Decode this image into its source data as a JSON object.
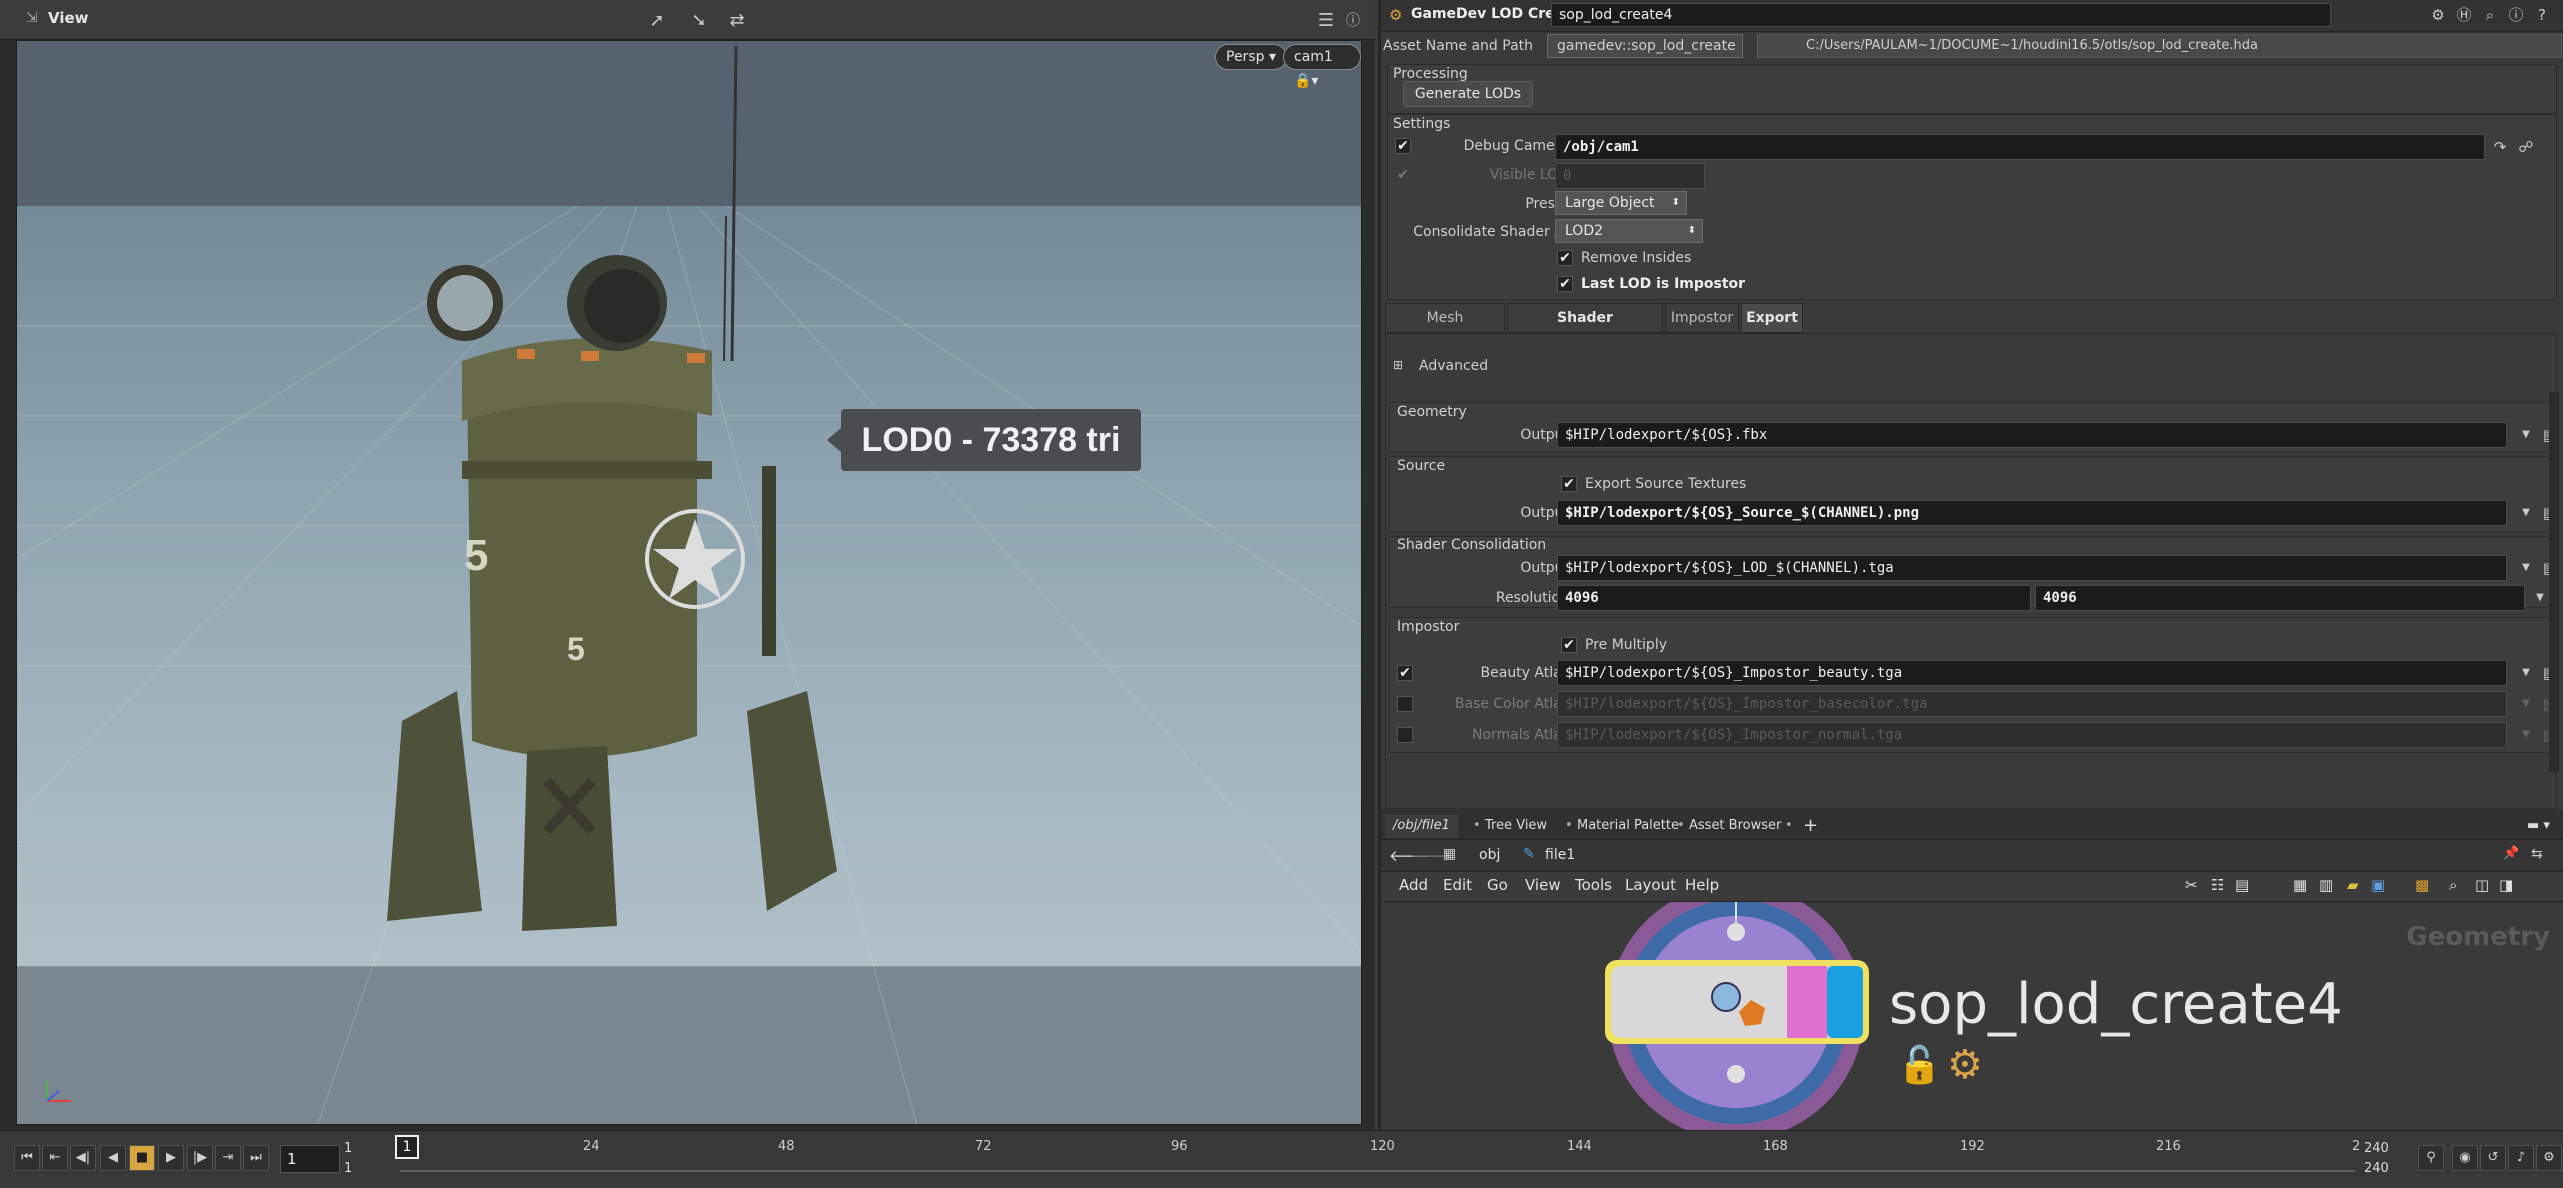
{
  "viewport": {
    "title": "View",
    "camera_mode": "Persp",
    "camera_name": "cam1",
    "lod_overlay": "LOD0 - 73378 tri",
    "tool_icons": [
      "select-arrow-icon",
      "transform-arrow-icon",
      "snap-icon"
    ],
    "robot_numbers": [
      "5",
      "5"
    ]
  },
  "timeline": {
    "current_frame": "1",
    "start_frame": "1",
    "start_frame_2": "1",
    "end_frame": "240",
    "end_frame_2": "240",
    "tick_labels": [
      "24",
      "48",
      "72",
      "96",
      "120",
      "144",
      "168",
      "192",
      "216",
      "2"
    ],
    "marker_frame": "1",
    "play_accent": "#d8a640"
  },
  "params": {
    "node_type": "GameDev LOD Create",
    "node_name": "sop_lod_create4",
    "asset_name_label": "Asset Name and Path",
    "asset_name_value": "gamedev::sop_lod_create",
    "asset_path": "C:/Users/PAULAM~1/DOCUME~1/houdini16.5/otls/sop_lod_create.hda",
    "processing_label": "Processing",
    "generate_button": "Generate LODs",
    "settings_label": "Settings",
    "debug_camera_label": "Debug Camera",
    "debug_camera_value": "/obj/cam1",
    "visible_lod_label": "Visible LOD",
    "visible_lod_value": "0",
    "preset_label": "Preset",
    "preset_value": "Large Object",
    "consolidate_label": "Consolidate Shader At",
    "consolidate_value": "LOD2",
    "remove_insides_label": "Remove Insides",
    "last_lod_label": "Last LOD is Impostor",
    "tabs": [
      "Mesh Decimation",
      "Shader Consolidation",
      "Impostor",
      "Export"
    ],
    "advanced_label": "Advanced",
    "geometry_section": "Geometry",
    "output_label": "Output",
    "geometry_output": "$HIP/lodexport/${OS}.fbx",
    "source_section": "Source",
    "export_source_textures_label": "Export Source Textures",
    "source_output": "$HIP/lodexport/${OS}_Source_$(CHANNEL).png",
    "shader_section": "Shader Consolidation",
    "shader_output": "$HIP/lodexport/${OS}_LOD_$(CHANNEL).tga",
    "resolution_label": "Resolution",
    "resolution_x": "4096",
    "resolution_y": "4096",
    "impostor_section": "Impostor",
    "premultiply_label": "Pre Multiply",
    "beauty_atlas_label": "Beauty Atlas",
    "beauty_atlas_value": "$HIP/lodexport/${OS}_Impostor_beauty.tga",
    "base_color_atlas_label": "Base Color Atlas",
    "base_color_atlas_value": "$HIP/lodexport/${OS}_Impostor_basecolor.tga",
    "normals_atlas_label": "Normals Atlas",
    "normals_atlas_value": "$HIP/lodexport/${OS}_Impostor_normal.tga"
  },
  "network": {
    "tabs": [
      "/obj/file1",
      "Tree View",
      "Material Palette",
      "Asset Browser"
    ],
    "path_obj": "obj",
    "path_node": "file1",
    "menu": [
      "Add",
      "Edit",
      "Go",
      "View",
      "Tools",
      "Layout",
      "Help"
    ],
    "context_label": "Geometry",
    "node_name": "sop_lod_create4",
    "node_flag_color": "#1aa0e0",
    "node_template_color": "#e070d0"
  }
}
